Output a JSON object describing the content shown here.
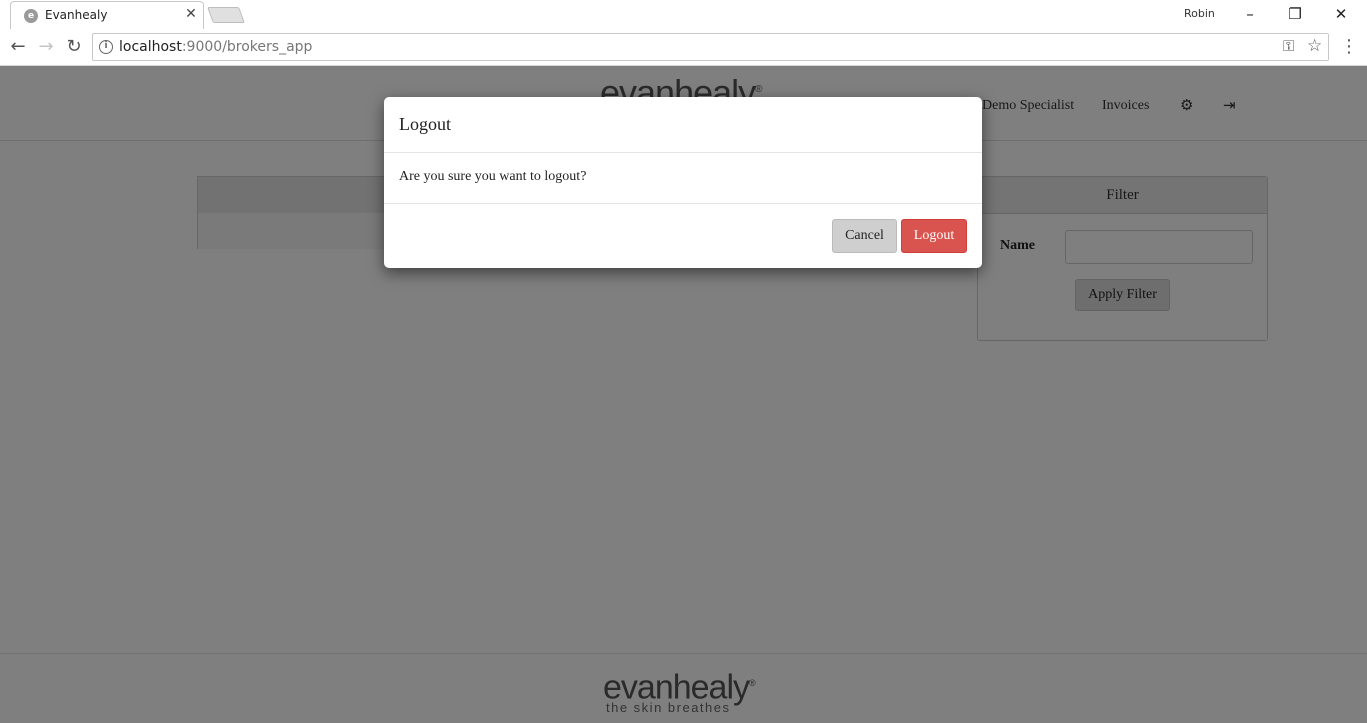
{
  "browser": {
    "tab_title": "Evanhealy",
    "favicon_letter": "e",
    "profile_name": "Robin",
    "url_host": "localhost",
    "url_path": ":9000/brokers_app",
    "icons": {
      "back": "arrow-left-icon",
      "forward": "arrow-right-icon",
      "reload": "reload-icon",
      "info": "info-icon",
      "key": "key-icon",
      "star": "star-icon",
      "menu": "menu-icon",
      "tab_close": "close-icon",
      "minimize": "minimize-icon",
      "restore": "restore-icon",
      "close": "close-icon"
    }
  },
  "header": {
    "brand": "evanhealy",
    "nav": {
      "demo_specialist": "Demo Specialist",
      "invoices": "Invoices"
    },
    "icons": {
      "settings": "gear-icon",
      "logout": "logout-icon"
    }
  },
  "filter": {
    "title": "Filter",
    "name_label": "Name",
    "name_value": "",
    "apply_label": "Apply Filter"
  },
  "footer": {
    "logo": "evanhealy",
    "tagline": "the skin breathes"
  },
  "modal": {
    "title": "Logout",
    "message": "Are you sure you want to logout?",
    "cancel_label": "Cancel",
    "logout_label": "Logout"
  },
  "colors": {
    "danger": "#d9534f",
    "backdrop": "rgba(0,0,0,0.5)"
  }
}
